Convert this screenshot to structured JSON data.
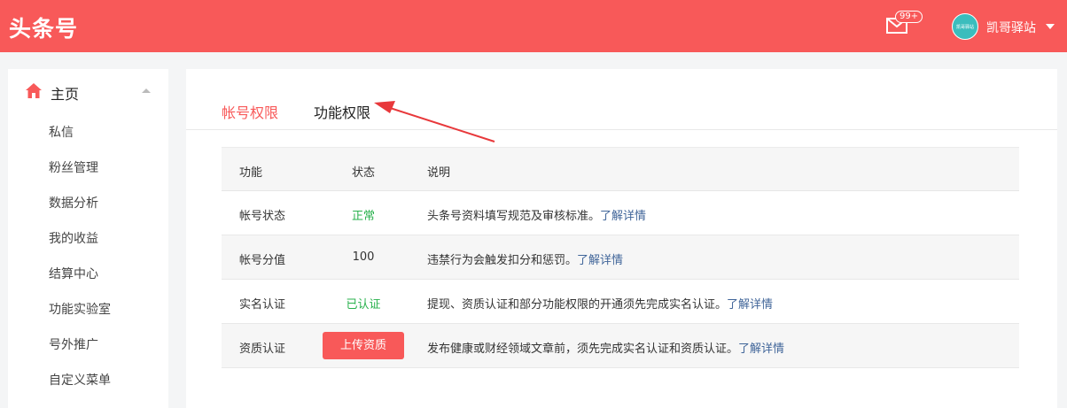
{
  "brand": {
    "logo": "头条号",
    "accent": "#f85959"
  },
  "header": {
    "mail_badge": "99+",
    "avatar_text": "凯哥驿站",
    "username": "凯哥驿站"
  },
  "sidebar": {
    "home": "主页",
    "items": [
      "私信",
      "粉丝管理",
      "数据分析",
      "我的收益",
      "结算中心",
      "功能实验室",
      "号外推广",
      "自定义菜单"
    ]
  },
  "tabs": {
    "account": "帐号权限",
    "function": "功能权限",
    "active": "帐号权限"
  },
  "table": {
    "headers": [
      "功能",
      "状态",
      "说明"
    ],
    "rows": [
      {
        "feature": "帐号状态",
        "status": "正常",
        "desc": "头条号资料填写规范及审核标准。",
        "link": "了解详情"
      },
      {
        "feature": "帐号分值",
        "status": "100",
        "desc": "违禁行为会触发扣分和惩罚。",
        "link": "了解详情"
      },
      {
        "feature": "实名认证",
        "status": "已认证",
        "desc": "提现、资质认证和部分功能权限的开通须先完成实名认证。",
        "link": "了解详情"
      },
      {
        "feature": "资质认证",
        "status": "上传资质",
        "desc": "发布健康或财经领域文章前，须先完成实名认证和资质认证。",
        "link": "了解详情"
      }
    ]
  }
}
